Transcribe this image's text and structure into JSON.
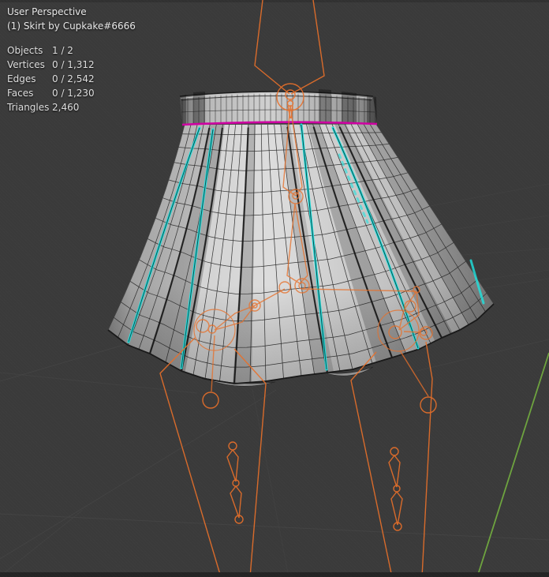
{
  "view": {
    "projection_label": "User Perspective",
    "active_object_label": "(1) Skirt by Cupkake#6666"
  },
  "stats": {
    "rows": [
      {
        "label": "Objects",
        "value": "1 / 2"
      },
      {
        "label": "Vertices",
        "value": "0 / 1,312"
      },
      {
        "label": "Edges",
        "value": "0 / 2,542"
      },
      {
        "label": "Faces",
        "value": "0 / 1,230"
      },
      {
        "label": "Triangles",
        "value": "2,460"
      }
    ]
  },
  "colors": {
    "background": "#3a3a3a",
    "grid_line": "#4d4d4d",
    "axis_y_green": "#6da33e",
    "wireframe": "#2b2b2b",
    "mesh_surface": "#cccccc",
    "seam_magenta": "#cf00a2",
    "sharp_edge_cyan": "#1ee3e0",
    "bone_orange": "#e8702a",
    "overlay_text": "#e9e9e9",
    "bottom_edge": "#242424"
  }
}
